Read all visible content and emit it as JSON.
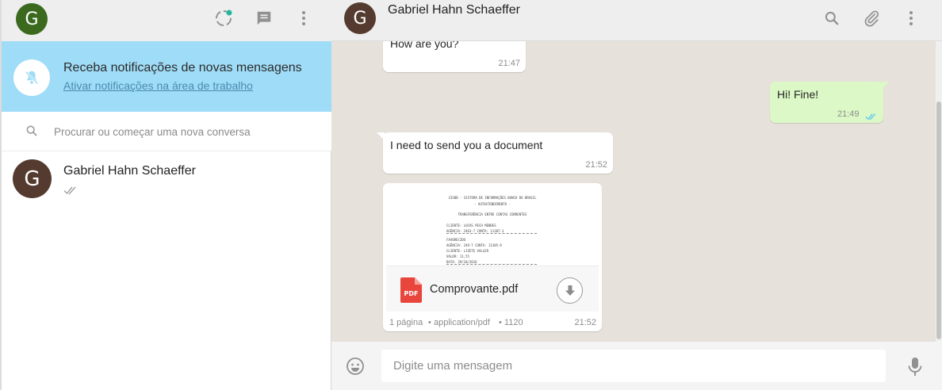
{
  "left_header": {
    "avatar_letter": "G",
    "icons": [
      "status-icon",
      "new-chat-icon",
      "menu-icon"
    ]
  },
  "notification": {
    "title": "Receba notificações de novas mensagens",
    "link": "Ativar notificações na área de trabalho",
    "icon": "bell-off-icon"
  },
  "search": {
    "placeholder": "Procurar ou começar uma nova conversa"
  },
  "chats": [
    {
      "avatar_letter": "G",
      "name": "Gabriel Hahn Schaeffer",
      "status": "double-tick-icon"
    }
  ],
  "conversation": {
    "contact_avatar_letter": "G",
    "contact_name": "Gabriel Hahn Schaeffer",
    "header_icons": [
      "search-icon",
      "attach-icon",
      "menu-icon"
    ],
    "messages": [
      {
        "direction": "in",
        "text": "How are you?",
        "time": "21:47"
      },
      {
        "direction": "out",
        "text": "Hi! Fine!",
        "time": "21:49",
        "status": "double-tick-icon"
      },
      {
        "direction": "in",
        "text": "I need to send you a document",
        "time": "21:52"
      },
      {
        "direction": "in",
        "type": "document",
        "file_name": "Comprovante.pdf",
        "pages": "1 página",
        "mime": "application/pdf",
        "size": "1120",
        "time": "21:52",
        "preview_lines": [
          "SISBB - SISTEMA DE INFORMAÇÕES BANCO DO BRASIL",
          "-   AUTOATENDIMENTO   -",
          "TRANSFERÊNCIA ENTRE CONTAS CORRENTES",
          "CLIENTE: LUCAS PECH MENDES",
          "AGÊNCIA: 2463-7     CONTA: 11387-3",
          "FAVORECIDO",
          "AGÊNCIA: 249-7     CONTA: 11305-9",
          "CLIENTE: LIZETE VALLER",
          "VALOR: 11,55",
          "DATA: 29/10/2016"
        ]
      }
    ]
  },
  "composer": {
    "placeholder": "Digite uma mensagem",
    "icons": [
      "emoji-icon",
      "mic-icon"
    ]
  },
  "colors": {
    "notification_bg": "#9fdcf7",
    "outgoing_bubble": "#dcf8c6",
    "chat_bg": "#e6e1da",
    "read_tick": "#4fc3f7"
  }
}
